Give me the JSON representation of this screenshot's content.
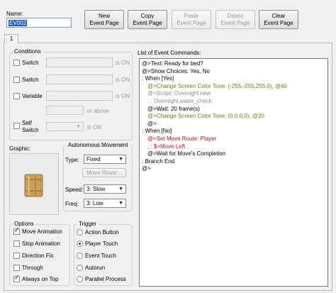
{
  "name_label": "Name:",
  "name_value": "EV002",
  "toolbar": {
    "new_page": [
      "New",
      "Event Page"
    ],
    "copy_page": [
      "Copy",
      "Event Page"
    ],
    "paste_page": [
      "Paste",
      "Event Page"
    ],
    "delete_page": [
      "Delete",
      "Event Page"
    ],
    "clear_page": [
      "Clear",
      "Event Page"
    ]
  },
  "tab_label": "1",
  "conditions": {
    "title": "Conditions",
    "switch1_label": "Switch",
    "switch2_label": "Switch",
    "variable_label": "Variable",
    "self_switch_label_1": "Self",
    "self_switch_label_2": "Switch",
    "is_on": "is ON",
    "or_above": "or above"
  },
  "graphic_title": "Graphic:",
  "autonomous": {
    "title": "Autonomous Movement",
    "type_label": "Type:",
    "type_value": "Fixed",
    "move_route_button": "Move Route...",
    "speed_label": "Speed:",
    "speed_value": "3: Slow",
    "freq_label": "Freq:",
    "freq_value": "3: Low"
  },
  "options": {
    "title": "Options",
    "items": [
      {
        "label": "Move Animation",
        "checked": true
      },
      {
        "label": "Stop Animation",
        "checked": false
      },
      {
        "label": "Direction Fix",
        "checked": false
      },
      {
        "label": "Through",
        "checked": false
      },
      {
        "label": "Always on Top",
        "checked": true
      }
    ]
  },
  "trigger": {
    "title": "Trigger",
    "items": [
      {
        "label": "Action Button",
        "selected": false
      },
      {
        "label": "Player Touch",
        "selected": true
      },
      {
        "label": "Event Touch",
        "selected": false
      },
      {
        "label": "Autorun",
        "selected": false
      },
      {
        "label": "Parallel Process",
        "selected": false
      }
    ]
  },
  "event_commands": {
    "title": "List of Event Commands:",
    "lines": [
      {
        "text": "@>Text: Ready for bed?",
        "color": "black",
        "indent": 0
      },
      {
        "text": "@>Show Choices: Yes, No",
        "color": "black",
        "indent": 0
      },
      {
        "text": ":   When [Yes]",
        "color": "black",
        "indent": 0
      },
      {
        "text": "@>Change Screen Color Tone: (-255,-255,255,0), @40",
        "color": "green",
        "indent": 1
      },
      {
        "text": "@>Script: Overnight.new",
        "color": "gray",
        "indent": 1
      },
      {
        "text": ":          : Overnight.water_check",
        "color": "gray",
        "indent": 1
      },
      {
        "text": "@>Wait: 20 frame(s)",
        "color": "black",
        "indent": 1
      },
      {
        "text": "@>Change Screen Color Tone: (0,0,0,0), @20",
        "color": "green",
        "indent": 1
      },
      {
        "text": "@>",
        "color": "black",
        "indent": 1
      },
      {
        "text": ":   When [No]",
        "color": "black",
        "indent": 0
      },
      {
        "text": "@>Set Move Route: Player",
        "color": "red",
        "indent": 1
      },
      {
        "text": ":               : $>Move Left",
        "color": "red",
        "indent": 1
      },
      {
        "text": "@>Wait for Move's Completion",
        "color": "black",
        "indent": 1
      },
      {
        "text": ":   Branch End",
        "color": "black",
        "indent": 0
      },
      {
        "text": "@>",
        "color": "black",
        "indent": 0
      }
    ]
  },
  "colors": {
    "green": "#6b7a12",
    "gray": "#8a8a8a",
    "red": "#b01818",
    "black": "#000000",
    "selection": "#1e5cc8"
  }
}
